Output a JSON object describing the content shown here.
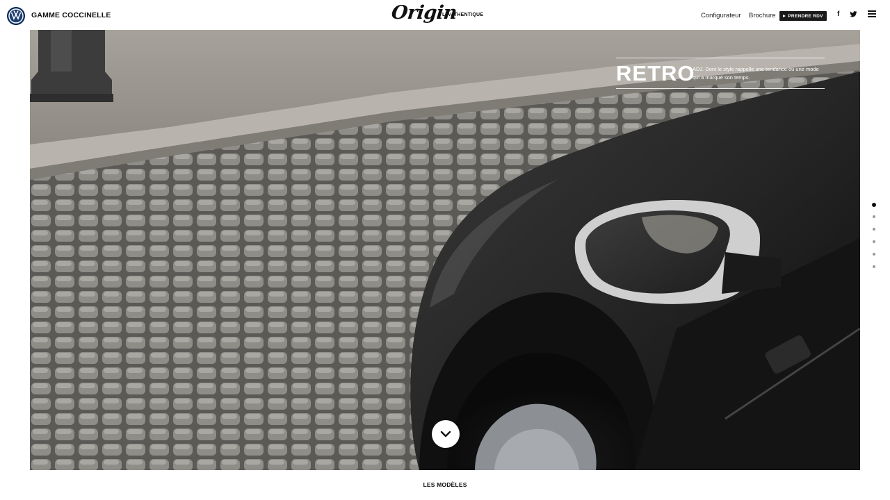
{
  "header": {
    "logo_icon": "vw-logo-icon",
    "title": "GAMME COCCINELLE",
    "brand": "Origin",
    "tagline": "L'AUTHENTIQUE",
    "nav": {
      "configurateur": "Configurateur",
      "brochure": "Brochure",
      "rdv": "PRENDRE RDV"
    },
    "social": {
      "facebook": "f",
      "twitter_icon": "twitter-icon"
    },
    "menu_icon": "hamburger-menu-icon"
  },
  "hero": {
    "word": "RETRO",
    "definition": "ADJ. Dont le style rappelle une tendance ou une mode qui a marqué son temps.",
    "scroll_icon": "chevron-down-icon"
  },
  "pagination": {
    "total": 6,
    "active_index": 0
  },
  "footer": {
    "next_section": "LES MODÈLES"
  },
  "colors": {
    "accent_dark": "#1a1a1a",
    "vw_blue": "#1c3f73"
  }
}
